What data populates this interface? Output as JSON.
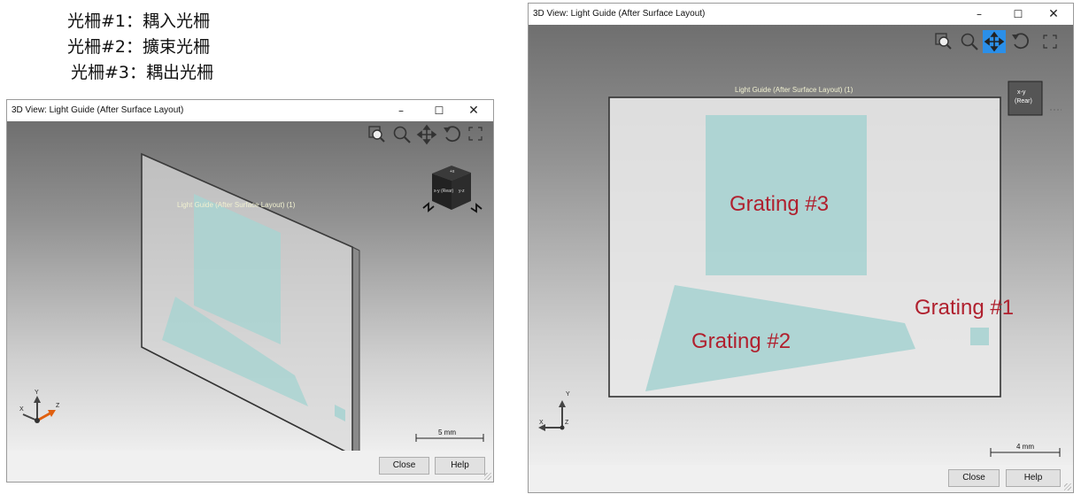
{
  "legend": [
    "光柵#1：耦入光柵",
    "光柵#2：擴束光柵",
    "光柵#3：耦出光柵"
  ],
  "left_window": {
    "title": "3D View: Light Guide (After Surface Layout)",
    "viewport_label": "Light Guide (After Surface Layout) (1)",
    "scale_label": "5 mm",
    "axes": {
      "x": "X",
      "y": "Y",
      "z": "Z"
    },
    "cube_faces": [
      "+x",
      "x-y (Rear)",
      "y-z"
    ],
    "buttons": {
      "close": "Close",
      "help": "Help"
    },
    "icons": [
      "zoom-window-icon",
      "zoom-icon",
      "pan-icon",
      "rotate-icon",
      "fit-view-icon"
    ]
  },
  "right_window": {
    "title": "3D View: Light Guide (After Surface Layout)",
    "viewport_label": "Light Guide (After Surface Layout) (1)",
    "scale_label": "4 mm",
    "axes": {
      "x": "X",
      "y": "Y",
      "z": "Z"
    },
    "view_cube": {
      "line1": "x-y",
      "line2": "(Rear)"
    },
    "gratings": {
      "g1": "Grating #1",
      "g2": "Grating #2",
      "g3": "Grating #3"
    },
    "buttons": {
      "close": "Close",
      "help": "Help"
    },
    "icons": [
      "zoom-window-icon",
      "zoom-icon",
      "pan-icon",
      "rotate-icon",
      "fit-view-icon"
    ],
    "active_icon": "pan-icon"
  },
  "colors": {
    "grating_fill": "#a9d3d1",
    "grating_label": "#b0202e",
    "active_tool_bg": "#2b8fe8"
  }
}
